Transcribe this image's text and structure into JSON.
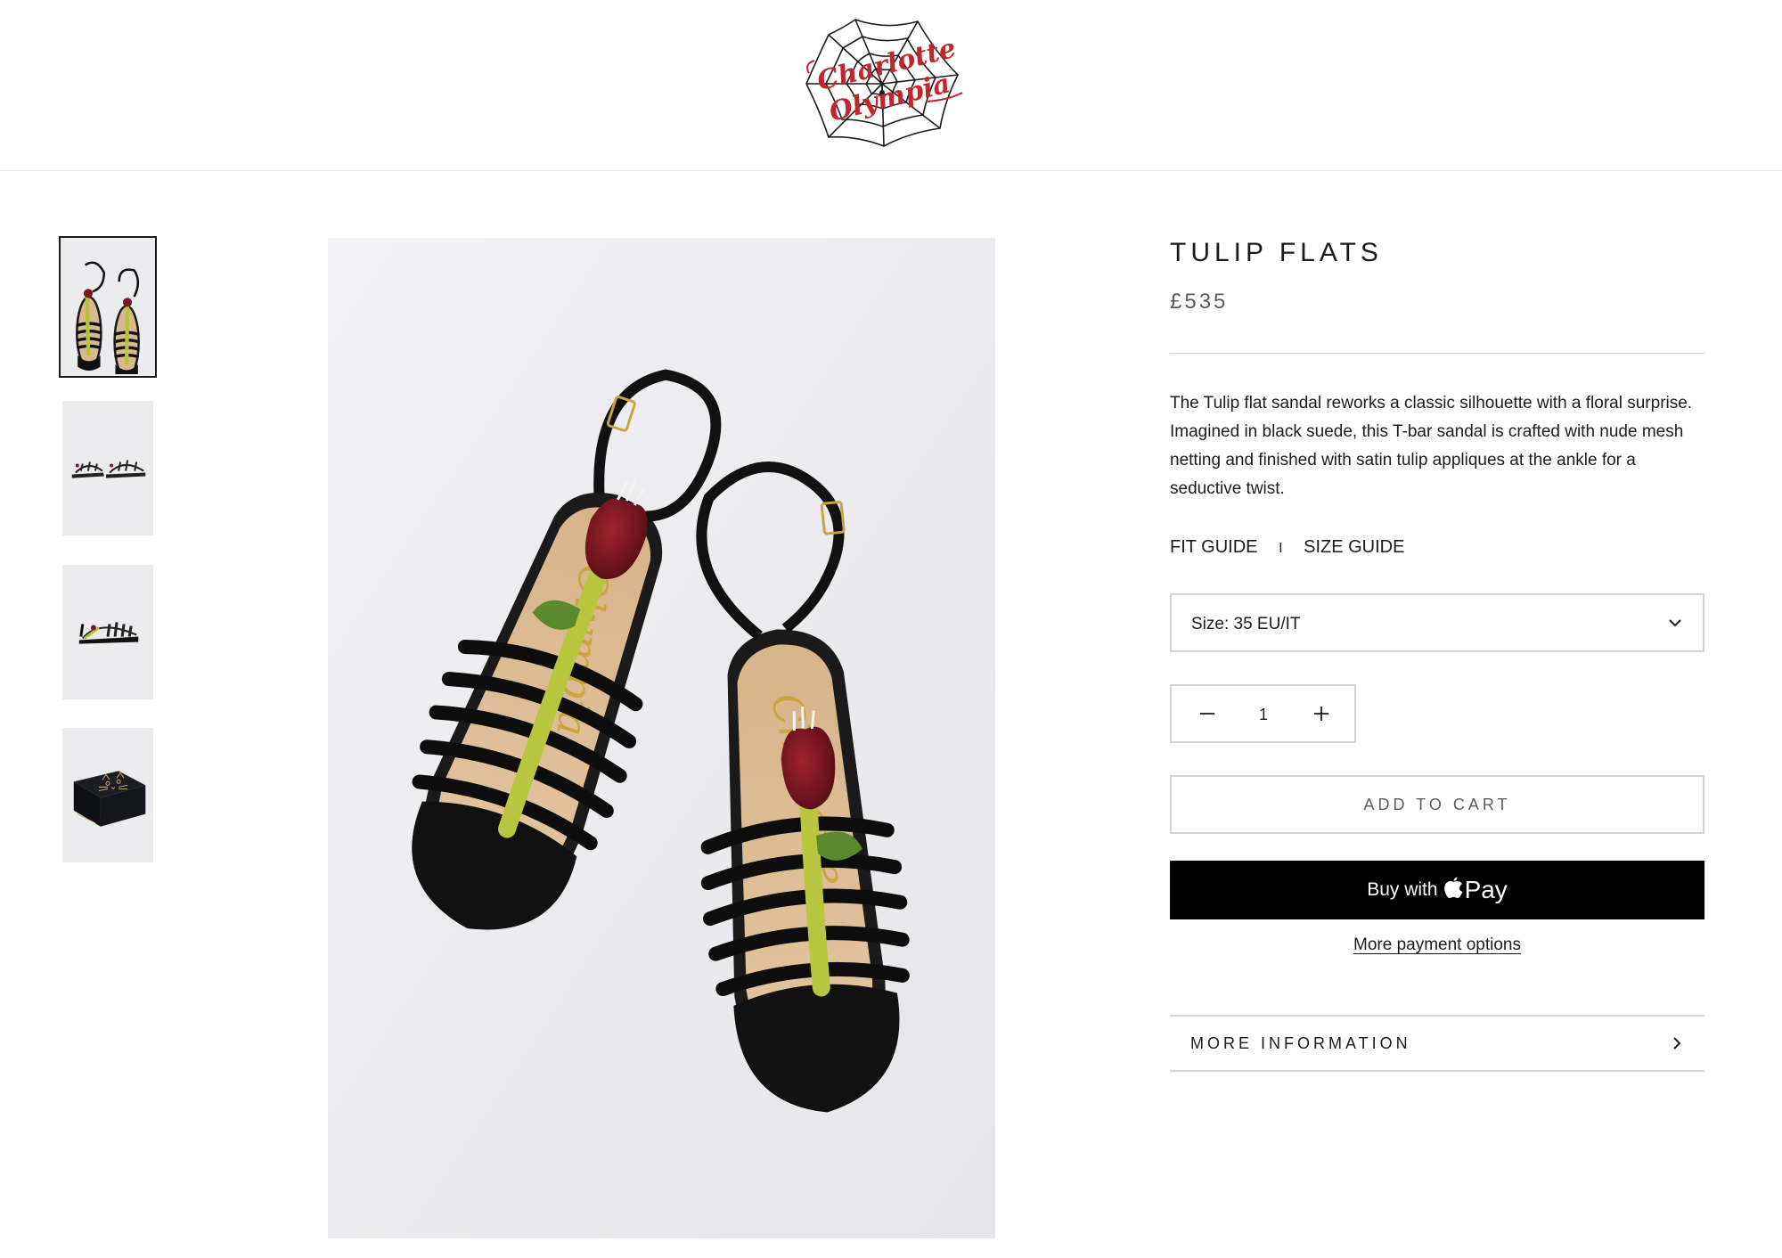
{
  "header": {
    "logo_text_line1": "Charlotte",
    "logo_text_line2": "Olympia",
    "logo_alt": "Charlotte Olympia"
  },
  "gallery": {
    "thumbnails": [
      {
        "name": "thumb-top-view",
        "active": true
      },
      {
        "name": "thumb-side-pair",
        "active": false
      },
      {
        "name": "thumb-side-single",
        "active": false
      },
      {
        "name": "thumb-box",
        "active": false
      }
    ]
  },
  "product": {
    "title": "TULIP FLATS",
    "price": "£535",
    "description": "The Tulip flat sandal reworks a classic silhouette with a floral surprise. Imagined in black suede, this T-bar sandal is crafted with nude mesh netting and finished with satin tulip appliques at the ankle for a seductive twist.",
    "fit_guide": "FIT GUIDE",
    "guide_separator": "I",
    "size_guide": "SIZE GUIDE",
    "size_select_label": "Size: 35 EU/IT",
    "quantity": "1",
    "add_to_cart": "ADD TO CART",
    "apple_pay_prefix": "Buy with",
    "apple_pay_suffix": "Pay",
    "more_payment_options": "More payment options",
    "more_information": "MORE INFORMATION"
  },
  "colors": {
    "text": "#1c1b1b",
    "muted": "#5c5c5c",
    "border": "#d4d4d4",
    "logo_red": "#c0262e",
    "button_black": "#000000"
  }
}
